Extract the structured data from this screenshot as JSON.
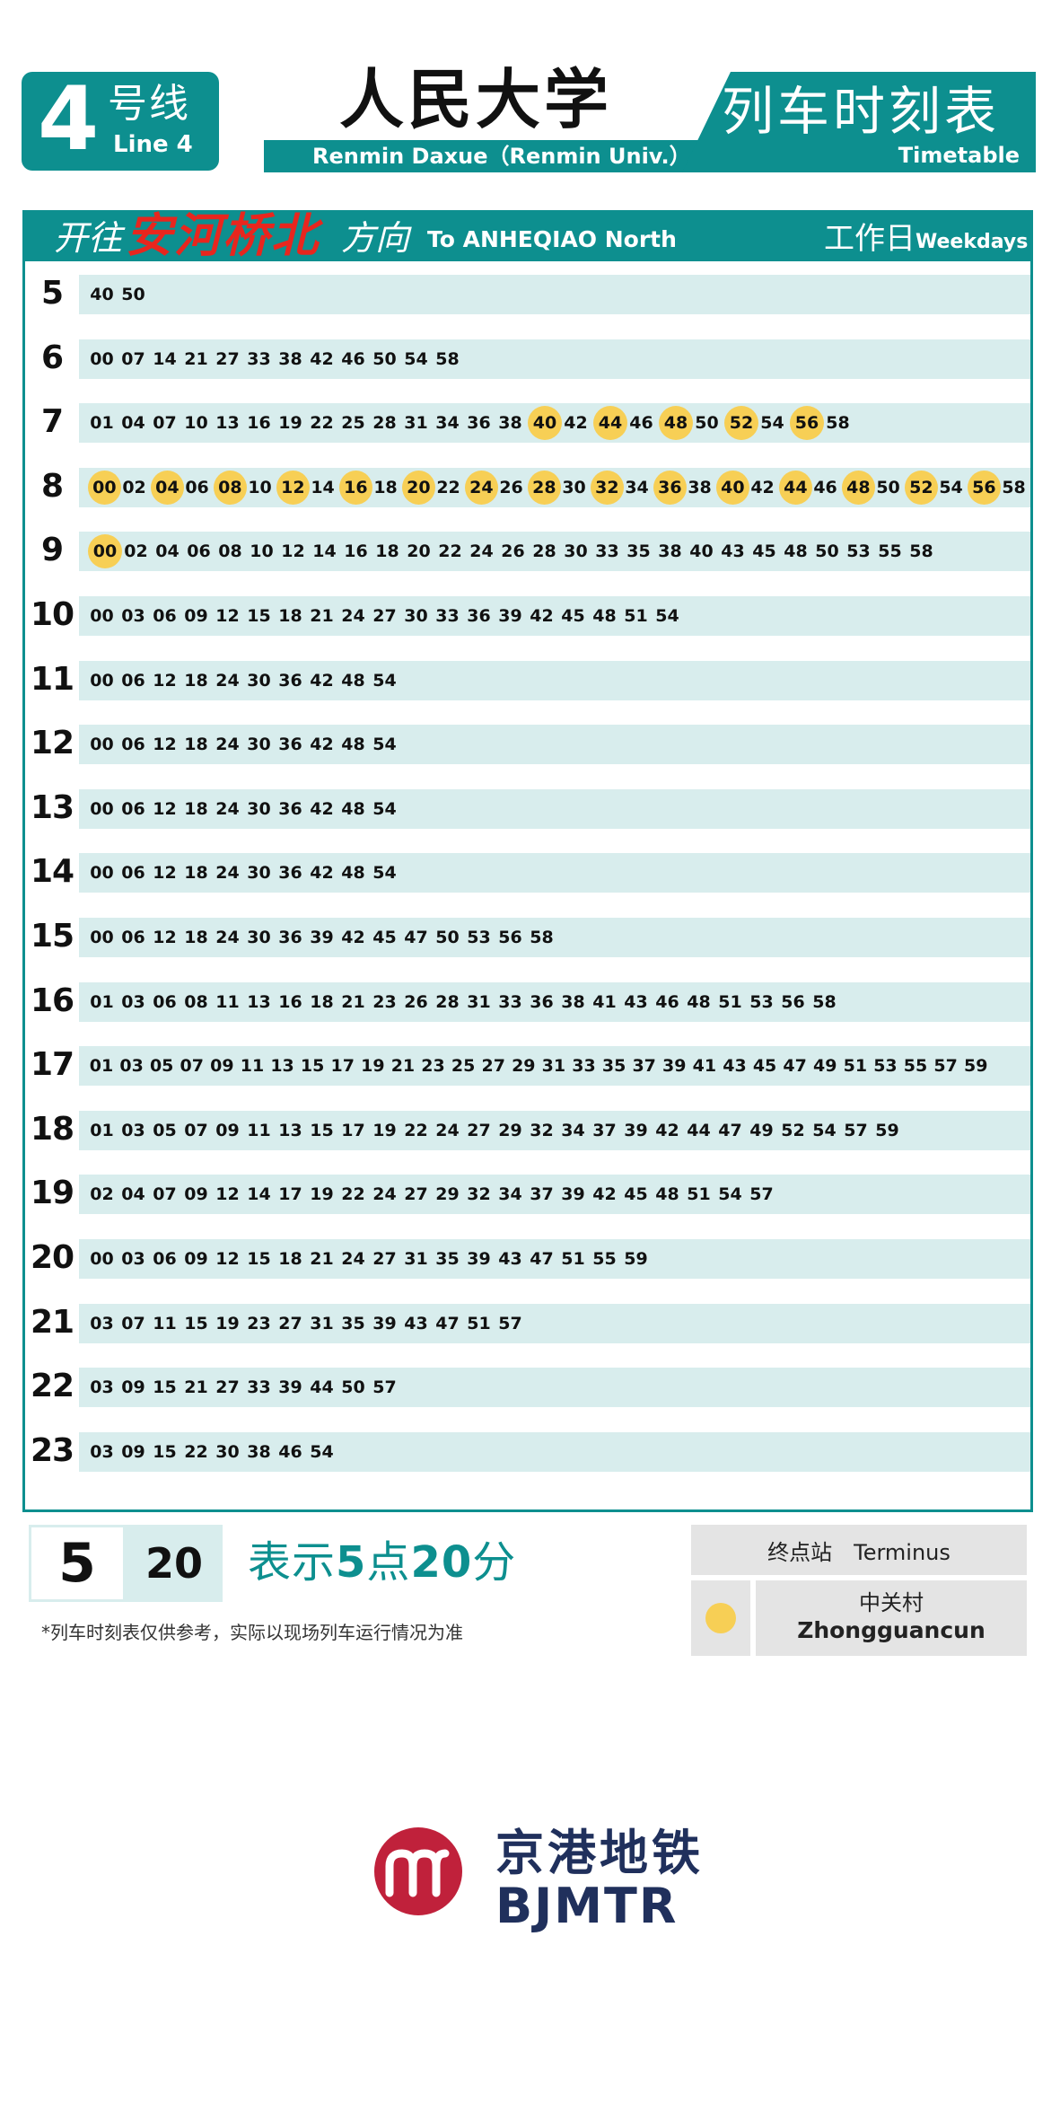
{
  "header": {
    "line_number": "4",
    "line_cn": "号线",
    "line_en": "Line 4",
    "station_cn": "人民大学",
    "station_en": "Renmin Daxue（Renmin Univ.）",
    "title_cn": "列车时刻表",
    "title_en": "Timetable"
  },
  "direction": {
    "prefix_cn": "开往",
    "destination_cn": "安河桥北",
    "suffix_cn": "方向",
    "destination_en": "To ANHEQIAO North",
    "day_cn": "工作日",
    "day_en": "Weekdays"
  },
  "schedule": [
    {
      "hour": "5",
      "minutes": [
        "40",
        "50"
      ],
      "terminus": []
    },
    {
      "hour": "6",
      "minutes": [
        "00",
        "07",
        "14",
        "21",
        "27",
        "33",
        "38",
        "42",
        "46",
        "50",
        "54",
        "58"
      ],
      "terminus": []
    },
    {
      "hour": "7",
      "minutes": [
        "01",
        "04",
        "07",
        "10",
        "13",
        "16",
        "19",
        "22",
        "25",
        "28",
        "31",
        "34",
        "36",
        "38",
        "40",
        "42",
        "44",
        "46",
        "48",
        "50",
        "52",
        "54",
        "56",
        "58"
      ],
      "terminus": [
        "40",
        "44",
        "48",
        "52",
        "56"
      ]
    },
    {
      "hour": "8",
      "minutes": [
        "00",
        "02",
        "04",
        "06",
        "08",
        "10",
        "12",
        "14",
        "16",
        "18",
        "20",
        "22",
        "24",
        "26",
        "28",
        "30",
        "32",
        "34",
        "36",
        "38",
        "40",
        "42",
        "44",
        "46",
        "48",
        "50",
        "52",
        "54",
        "56",
        "58"
      ],
      "terminus": [
        "00",
        "04",
        "08",
        "12",
        "16",
        "20",
        "24",
        "28",
        "32",
        "36",
        "40",
        "44",
        "48",
        "52",
        "56"
      ]
    },
    {
      "hour": "9",
      "minutes": [
        "00",
        "02",
        "04",
        "06",
        "08",
        "10",
        "12",
        "14",
        "16",
        "18",
        "20",
        "22",
        "24",
        "26",
        "28",
        "30",
        "33",
        "35",
        "38",
        "40",
        "43",
        "45",
        "48",
        "50",
        "53",
        "55",
        "58"
      ],
      "terminus": [
        "00"
      ]
    },
    {
      "hour": "10",
      "minutes": [
        "00",
        "03",
        "06",
        "09",
        "12",
        "15",
        "18",
        "21",
        "24",
        "27",
        "30",
        "33",
        "36",
        "39",
        "42",
        "45",
        "48",
        "51",
        "54"
      ],
      "terminus": []
    },
    {
      "hour": "11",
      "minutes": [
        "00",
        "06",
        "12",
        "18",
        "24",
        "30",
        "36",
        "42",
        "48",
        "54"
      ],
      "terminus": []
    },
    {
      "hour": "12",
      "minutes": [
        "00",
        "06",
        "12",
        "18",
        "24",
        "30",
        "36",
        "42",
        "48",
        "54"
      ],
      "terminus": []
    },
    {
      "hour": "13",
      "minutes": [
        "00",
        "06",
        "12",
        "18",
        "24",
        "30",
        "36",
        "42",
        "48",
        "54"
      ],
      "terminus": []
    },
    {
      "hour": "14",
      "minutes": [
        "00",
        "06",
        "12",
        "18",
        "24",
        "30",
        "36",
        "42",
        "48",
        "54"
      ],
      "terminus": []
    },
    {
      "hour": "15",
      "minutes": [
        "00",
        "06",
        "12",
        "18",
        "24",
        "30",
        "36",
        "39",
        "42",
        "45",
        "47",
        "50",
        "53",
        "56",
        "58"
      ],
      "terminus": []
    },
    {
      "hour": "16",
      "minutes": [
        "01",
        "03",
        "06",
        "08",
        "11",
        "13",
        "16",
        "18",
        "21",
        "23",
        "26",
        "28",
        "31",
        "33",
        "36",
        "38",
        "41",
        "43",
        "46",
        "48",
        "51",
        "53",
        "56",
        "58"
      ],
      "terminus": []
    },
    {
      "hour": "17",
      "minutes": [
        "01",
        "03",
        "05",
        "07",
        "09",
        "11",
        "13",
        "15",
        "17",
        "19",
        "21",
        "23",
        "25",
        "27",
        "29",
        "31",
        "33",
        "35",
        "37",
        "39",
        "41",
        "43",
        "45",
        "47",
        "49",
        "51",
        "53",
        "55",
        "57",
        "59"
      ],
      "terminus": []
    },
    {
      "hour": "18",
      "minutes": [
        "01",
        "03",
        "05",
        "07",
        "09",
        "11",
        "13",
        "15",
        "17",
        "19",
        "22",
        "24",
        "27",
        "29",
        "32",
        "34",
        "37",
        "39",
        "42",
        "44",
        "47",
        "49",
        "52",
        "54",
        "57",
        "59"
      ],
      "terminus": []
    },
    {
      "hour": "19",
      "minutes": [
        "02",
        "04",
        "07",
        "09",
        "12",
        "14",
        "17",
        "19",
        "22",
        "24",
        "27",
        "29",
        "32",
        "34",
        "37",
        "39",
        "42",
        "45",
        "48",
        "51",
        "54",
        "57"
      ],
      "terminus": []
    },
    {
      "hour": "20",
      "minutes": [
        "00",
        "03",
        "06",
        "09",
        "12",
        "15",
        "18",
        "21",
        "24",
        "27",
        "31",
        "35",
        "39",
        "43",
        "47",
        "51",
        "55",
        "59"
      ],
      "terminus": []
    },
    {
      "hour": "21",
      "minutes": [
        "03",
        "07",
        "11",
        "15",
        "19",
        "23",
        "27",
        "31",
        "35",
        "39",
        "43",
        "47",
        "51",
        "57"
      ],
      "terminus": []
    },
    {
      "hour": "22",
      "minutes": [
        "03",
        "09",
        "15",
        "21",
        "27",
        "33",
        "39",
        "44",
        "50",
        "57"
      ],
      "terminus": []
    },
    {
      "hour": "23",
      "minutes": [
        "03",
        "09",
        "15",
        "22",
        "30",
        "38",
        "46",
        "54"
      ],
      "terminus": []
    }
  ],
  "legend": {
    "example_hour": "5",
    "example_minute": "20",
    "example_pre": "表示",
    "example_h": "5",
    "example_mid": "点",
    "example_m": "20",
    "example_post": "分",
    "note": "*列车时刻表仅供参考，实际以现场列车运行情况为准",
    "terminus_label": "终点站　Terminus",
    "terminus_station_cn": "中关村",
    "terminus_station_en": "Zhongguancun"
  },
  "logo": {
    "cn": "京港地铁",
    "en": "BJMTR"
  },
  "colors": {
    "brand_teal": "#0d8f8f",
    "row_band": "#d8eded",
    "terminus_highlight": "#f7cf55",
    "destination_red": "#e8261e",
    "logo_red": "#c0213b",
    "logo_navy": "#20305c"
  }
}
